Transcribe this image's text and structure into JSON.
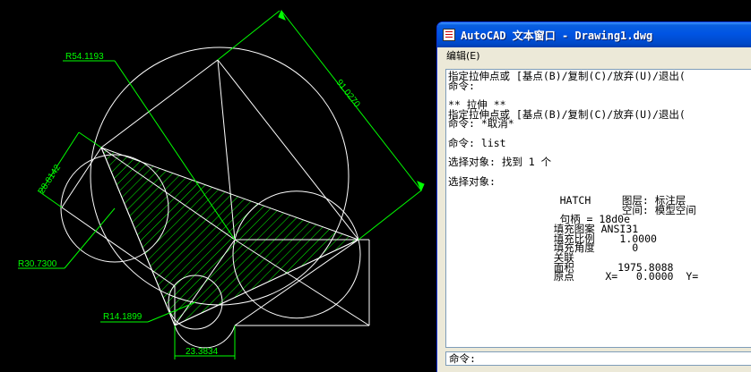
{
  "drawing": {
    "dim_r54": "R54.1193",
    "dim_918": "91.0270",
    "dim_288": "28.8142",
    "dim_r30": "R30.7300",
    "dim_r14": "R14.1899",
    "dim_23": "23.3834"
  },
  "window": {
    "title": "AutoCAD 文本窗口 - Drawing1.dwg",
    "menu_edit": "编辑(E)",
    "lines": [
      "指定拉伸点或 [基点(B)/复制(C)/放弃(U)/退出(",
      "命令:",
      "",
      "** 拉伸 **",
      "指定拉伸点或 [基点(B)/复制(C)/放弃(U)/退出(",
      "命令: *取消*",
      "",
      "命令: list",
      "",
      "选择对象: 找到 1 个",
      "",
      "选择对象:",
      "",
      "                  HATCH     图层: 标注层",
      "                            空间: 模型空间",
      "                  句柄 = 18d0e",
      "                 填充图案 ANSI31",
      "                 填充比例    1.0000",
      "                 填充角度      0",
      "                 关联",
      "                 面积       1975.8088",
      "                 原点     X=   0.0000  Y="
    ],
    "prompt": "命令:"
  },
  "colors": {
    "background": "#000000",
    "geometry": "#ffffff",
    "dimension": "#00ff00",
    "titlebar": "#0054e3"
  }
}
